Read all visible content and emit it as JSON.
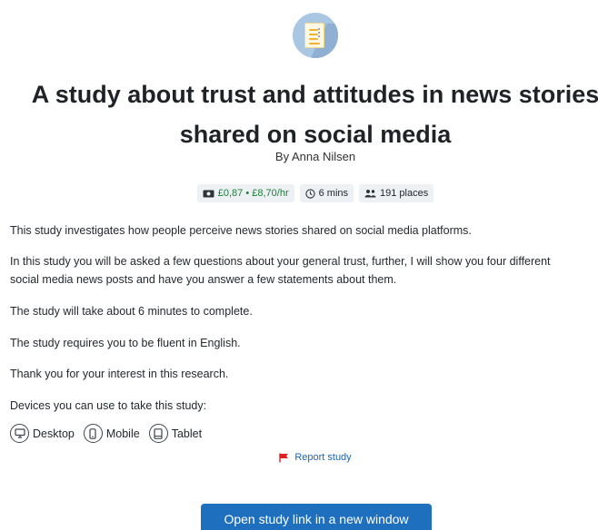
{
  "study": {
    "title_line1": "A study about trust and attitudes in news stories",
    "title_line2": "shared on social media",
    "author": "By Anna Nilsen",
    "icon": "document-icon"
  },
  "badges": {
    "reward": "£0,87 • £8,70/hr",
    "reward_icon": "cash-icon",
    "time": "6 mins",
    "time_icon": "clock-icon",
    "places": "191 places",
    "places_icon": "people-icon"
  },
  "description": {
    "p1": "This study investigates how people perceive news stories shared on social media platforms.",
    "p2_line1": "In this study you will be asked a few questions about your general trust, further, I will show you four different",
    "p2_line2": "social media news posts and have you answer a few statements about them.",
    "p3": "The study will take about 6 minutes to complete.",
    "p4": "The study requires you to be fluent in English.",
    "p5": "Thank you for your interest in this research.",
    "p6": "Devices you can use to take this study:"
  },
  "devices": [
    {
      "label": "Desktop",
      "icon": "desktop-icon"
    },
    {
      "label": "Mobile",
      "icon": "mobile-icon"
    },
    {
      "label": "Tablet",
      "icon": "tablet-icon"
    }
  ],
  "report": {
    "label": "Report study",
    "icon": "flag-icon",
    "color": "#e02020"
  },
  "open_button": {
    "label": "Open study link in a new window",
    "color": "#1f6fbf"
  }
}
